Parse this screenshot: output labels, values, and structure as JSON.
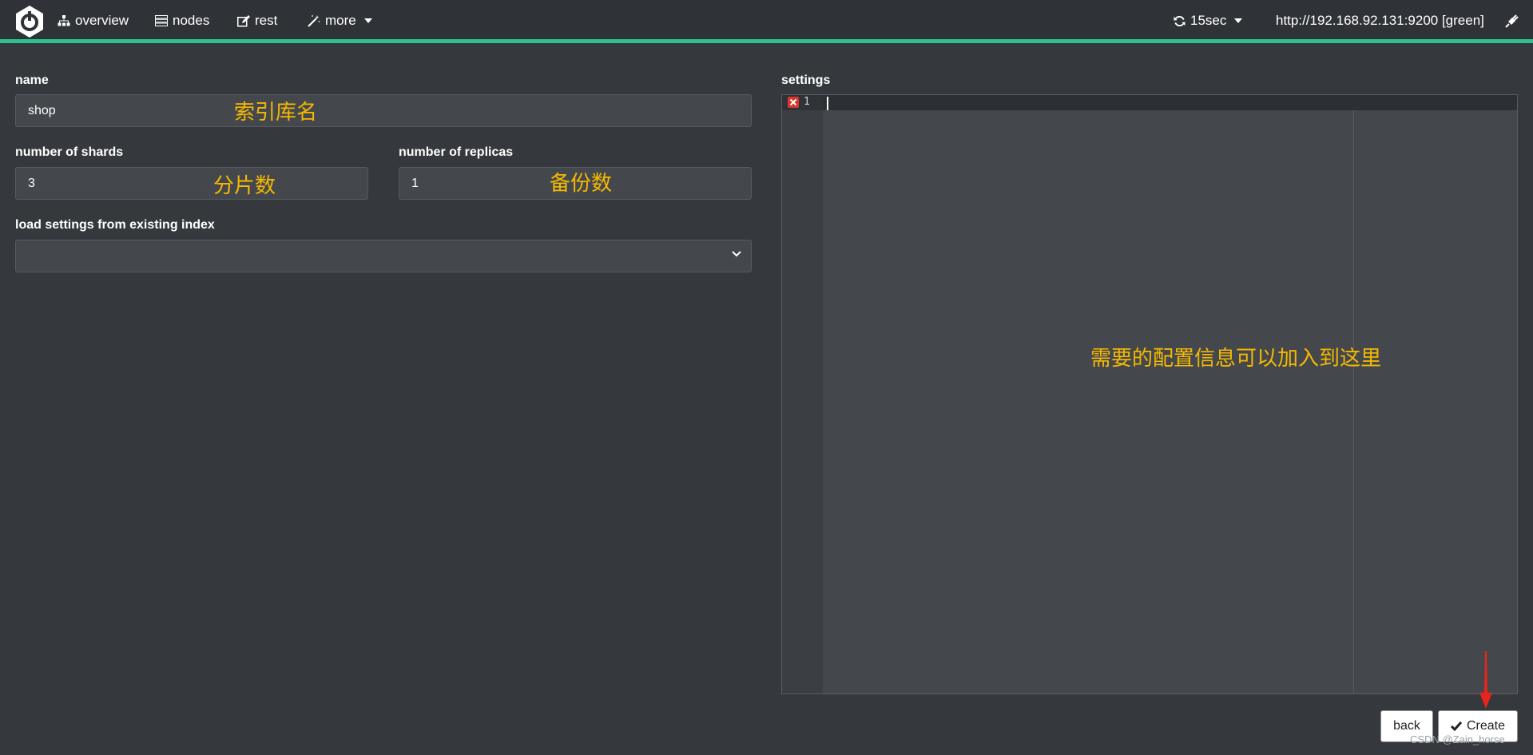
{
  "nav": {
    "overview_label": "overview",
    "nodes_label": "nodes",
    "rest_label": "rest",
    "more_label": "more",
    "refresh_label": "15sec",
    "cluster_url": "http://192.168.92.131:9200 [green]"
  },
  "form": {
    "name_label": "name",
    "name_value": "shop",
    "shards_label": "number of shards",
    "shards_value": "3",
    "replicas_label": "number of replicas",
    "replicas_value": "1",
    "load_label": "load settings from existing index",
    "load_value": ""
  },
  "settings": {
    "label": "settings",
    "line_number": "1"
  },
  "annotations": {
    "name_note": "索引库名",
    "shards_note": "分片数",
    "replicas_note": "备份数",
    "settings_note": "需要的配置信息可以加入到这里"
  },
  "buttons": {
    "back_label": "back",
    "create_label": "Create"
  },
  "watermark": "CSDN @Zain_horse",
  "colors": {
    "accent": "#2ec28f",
    "annotation": "#f5b800",
    "arrow": "#e8241b",
    "error": "#d9372a"
  }
}
